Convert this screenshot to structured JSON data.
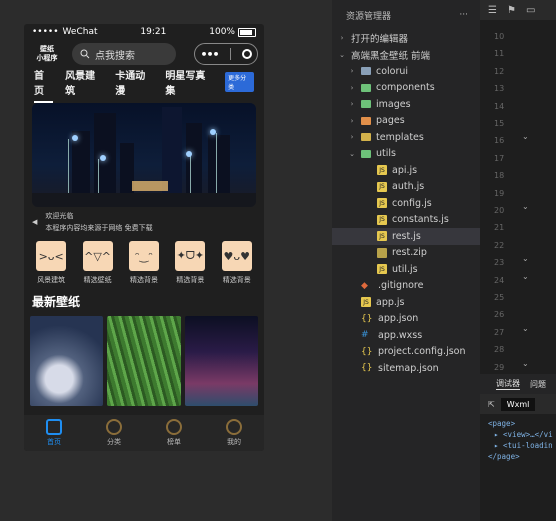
{
  "phone": {
    "status": {
      "carrier": "WeChat",
      "time": "19:21",
      "battery": "100%"
    },
    "logo_line1": "壁纸",
    "logo_line2": "小程序",
    "search_placeholder": "点我搜索",
    "tabs": [
      "首页",
      "风景建筑",
      "卡通动漫",
      "明星写真集"
    ],
    "more_tag": "更多分类",
    "notice_line1": "欢迎光临",
    "notice_line2": "本程序内容均来源于网络 免费下载",
    "categories": [
      "风景建筑",
      "精选壁纸",
      "精选背景",
      "精选背景",
      "精选背景"
    ],
    "latest_title": "最新壁纸",
    "tabbar": [
      "首页",
      "分类",
      "榜单",
      "我的"
    ]
  },
  "explorer": {
    "title": "资源管理器",
    "more": "···",
    "open_editors": "打开的编辑器",
    "project": "高端黑金壁纸 前端",
    "items": [
      {
        "name": "colorui",
        "type": "folder",
        "depth": 1,
        "arrow": "›"
      },
      {
        "name": "components",
        "type": "folder-g",
        "depth": 1,
        "arrow": "›"
      },
      {
        "name": "images",
        "type": "folder-g",
        "depth": 1,
        "arrow": "›"
      },
      {
        "name": "pages",
        "type": "folder-o",
        "depth": 1,
        "arrow": "›"
      },
      {
        "name": "templates",
        "type": "folder-y",
        "depth": 1,
        "arrow": "›"
      },
      {
        "name": "utils",
        "type": "folder-g",
        "depth": 1,
        "arrow": "⌄"
      },
      {
        "name": "api.js",
        "type": "js",
        "depth": 2
      },
      {
        "name": "auth.js",
        "type": "js",
        "depth": 2
      },
      {
        "name": "config.js",
        "type": "js",
        "depth": 2
      },
      {
        "name": "constants.js",
        "type": "js",
        "depth": 2
      },
      {
        "name": "rest.js",
        "type": "js",
        "depth": 2,
        "selected": true
      },
      {
        "name": "rest.zip",
        "type": "zip",
        "depth": 2
      },
      {
        "name": "util.js",
        "type": "js",
        "depth": 2
      },
      {
        "name": ".gitignore",
        "type": "git",
        "depth": 1
      },
      {
        "name": "app.js",
        "type": "js",
        "depth": 1
      },
      {
        "name": "app.json",
        "type": "json",
        "depth": 1
      },
      {
        "name": "app.wxss",
        "type": "wxss",
        "depth": 1
      },
      {
        "name": "project.config.json",
        "type": "json",
        "depth": 1
      },
      {
        "name": "sitemap.json",
        "type": "json",
        "depth": 1
      }
    ]
  },
  "editor": {
    "line_numbers": [
      "10",
      "11",
      "12",
      "13",
      "14",
      "15",
      "16",
      "17",
      "18",
      "19",
      "20",
      "21",
      "22",
      "23",
      "24",
      "25",
      "26",
      "27",
      "28",
      "29"
    ]
  },
  "debug": {
    "tabs": [
      "调试器",
      "问题"
    ],
    "panel": "Wxml",
    "code": [
      "<page>",
      "<view>…</vi",
      "<tui-loadin",
      "</page>"
    ]
  }
}
